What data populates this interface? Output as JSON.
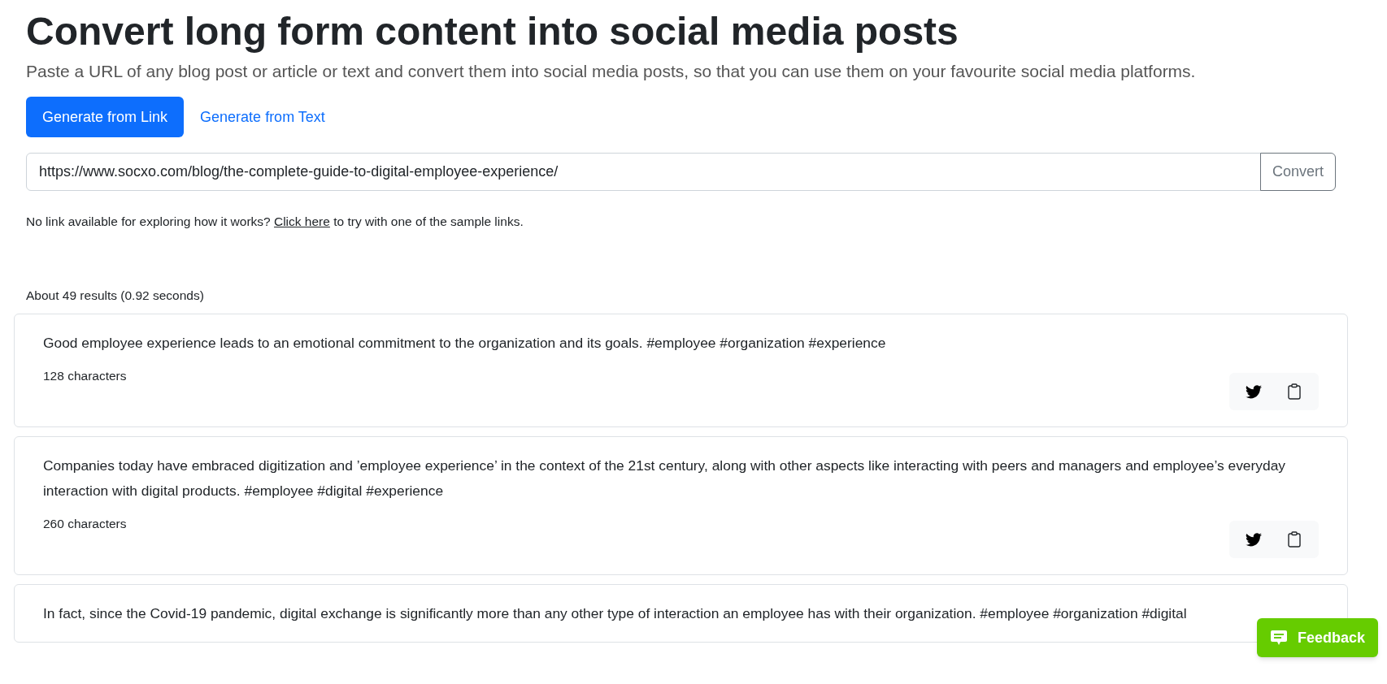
{
  "title": "Convert long form content into social media posts",
  "subtitle": "Paste a URL of any blog post or article or text and convert them into social media posts, so that you can use them on your favourite social media platforms.",
  "tabs": [
    {
      "label": "Generate from Link",
      "selected": true
    },
    {
      "label": "Generate from Text",
      "selected": false
    }
  ],
  "url_field": {
    "value": "https://www.socxo.com/blog/the-complete-guide-to-digital-employee-experience/"
  },
  "convert_button": "Convert",
  "helper": {
    "before": "No link available for exploring how it works?",
    "link": "Click here",
    "after": "to try with one of the sample links."
  },
  "results_summary": "About 49 results (0.92 seconds)",
  "posts": [
    {
      "text": "Good employee experience leads to an emotional commitment to the organization and its goals. #employee #organization #experience",
      "count": "128 characters"
    },
    {
      "text": "Companies today have embraced digitization and ’employee experience’ in the context of the 21st century, along with other aspects like interacting with peers and managers and employee’s everyday interaction with digital products. #employee #digital #experience",
      "count": "260 characters"
    },
    {
      "text": "In fact, since the Covid-19 pandemic, digital exchange is significantly more than any other type of interaction an employee has with their organization. #employee #organization #digital"
    }
  ],
  "feedback_button": "Feedback"
}
